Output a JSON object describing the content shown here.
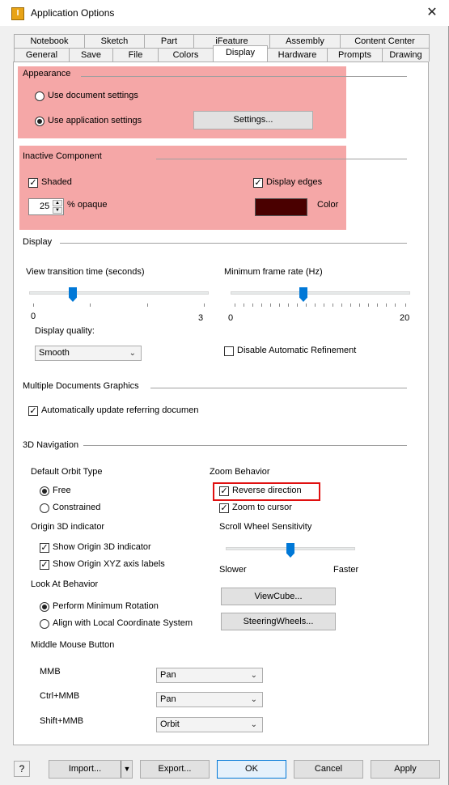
{
  "window": {
    "title": "Application Options",
    "close_glyph": "✕"
  },
  "tabs_row1": [
    "Notebook",
    "Sketch",
    "Part",
    "iFeature",
    "Assembly",
    "Content Center"
  ],
  "tabs_row2": [
    "General",
    "Save",
    "File",
    "Colors",
    "Display",
    "Hardware",
    "Prompts",
    "Drawing"
  ],
  "active_tab": "Display",
  "appearance": {
    "title": "Appearance",
    "option1": "Use document settings",
    "option2": "Use application settings",
    "settings_button": "Settings..."
  },
  "inactive": {
    "title": "Inactive Component Appearance",
    "shaded": "Shaded",
    "display_edges": "Display edges",
    "opacity_value": "25",
    "opacity_label": "% opaque",
    "color_label": "Color",
    "color_swatch": "#4a0000"
  },
  "display": {
    "title": "Display",
    "view_transition_label": "View transition time (seconds)",
    "vt_min": "0",
    "vt_max": "3",
    "min_frame_label": "Minimum frame rate (Hz)",
    "mf_min": "0",
    "mf_max": "20",
    "quality_label": "Display quality:",
    "quality_value": "Smooth",
    "disable_refinement": "Disable Automatic Refinement"
  },
  "multi_docs": {
    "title": "Multiple Documents Graphics",
    "auto_update": "Automatically update referring documen"
  },
  "nav3d": {
    "title": "3D Navigation",
    "orbit_title": "Default Orbit Type",
    "orbit_free": "Free",
    "orbit_constrained": "Constrained",
    "zoom_title": "Zoom Behavior",
    "reverse_direction": "Reverse direction",
    "zoom_to_cursor": "Zoom to cursor",
    "origin_title": "Origin 3D indicator",
    "show_origin": "Show Origin 3D indicator",
    "show_xyz": "Show Origin XYZ axis labels",
    "scroll_title": "Scroll Wheel Sensitivity",
    "slower": "Slower",
    "faster": "Faster",
    "lookat_title": "Look At Behavior",
    "perform_min_rot": "Perform Minimum Rotation",
    "align_local": "Align with Local Coordinate System",
    "viewcube_button": "ViewCube...",
    "steeringwheels_button": "SteeringWheels...",
    "mmb_title": "Middle Mouse Button",
    "mmb_label": "MMB",
    "ctrl_mmb_label": "Ctrl+MMB",
    "shift_mmb_label": "Shift+MMB",
    "mmb_value": "Pan",
    "ctrl_mmb_value": "Pan",
    "shift_mmb_value": "Orbit"
  },
  "footer": {
    "help": "?",
    "import": "Import...",
    "export": "Export...",
    "ok": "OK",
    "cancel": "Cancel",
    "apply": "Apply"
  }
}
